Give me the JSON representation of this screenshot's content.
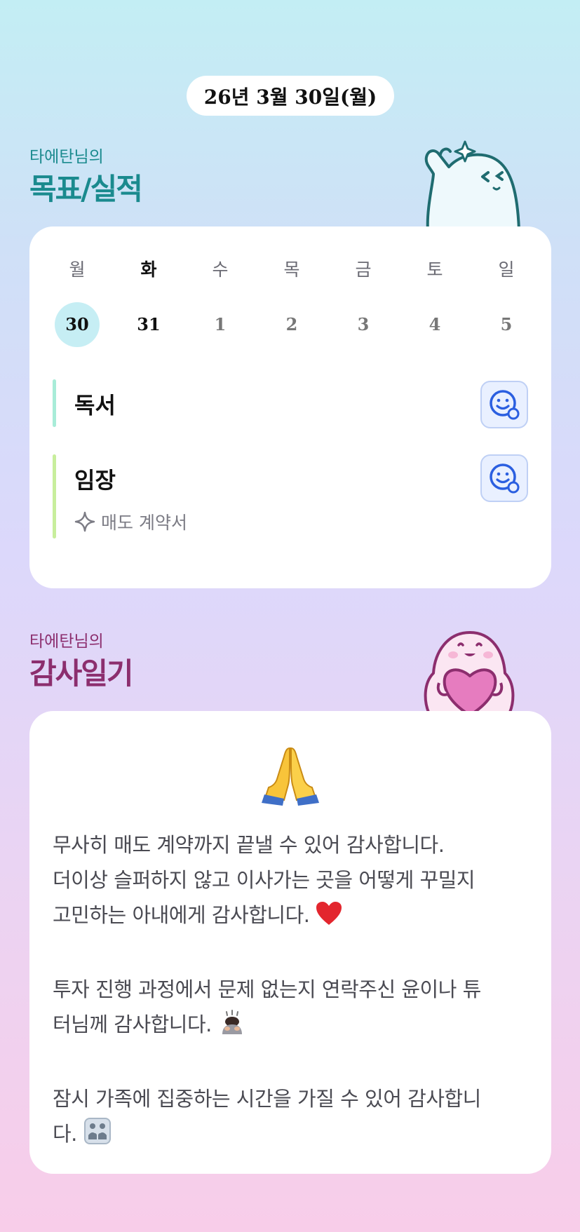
{
  "date_label": "26년 3월 30일(월)",
  "goals_section": {
    "owner": "타에탄님의",
    "title": "목표/실적"
  },
  "week": {
    "day_names": [
      "월",
      "화",
      "수",
      "목",
      "금",
      "토",
      "일"
    ],
    "day_numbers": [
      "30",
      "31",
      "1",
      "2",
      "3",
      "4",
      "5"
    ],
    "selected_index": 0
  },
  "goals": [
    {
      "label": "독서",
      "bar_color": "#a8ecd8",
      "icon": "smile-face-icon"
    },
    {
      "label": "임장",
      "bar_color": "#c8ee9c",
      "icon": "smile-face-icon",
      "subitem": "매도 계약서",
      "subitem_icon": "sparkle-icon"
    }
  ],
  "diary_section": {
    "owner": "타에탄님의",
    "title": "감사일기"
  },
  "diary": {
    "mood_emoji": "folded-hands-emoji",
    "paragraph1_line1": "무사히 매도 계약까지 끝낼 수 있어 감사합니다.",
    "paragraph1_line2": "더이상 슬퍼하지 않고 이사가는 곳을 어떻게 꾸밀지",
    "paragraph1_line3": "고민하는 아내에게 감사합니다.",
    "paragraph2_line1": "투자 진행 과정에서 문제 없는지 연락주신 윤이나 튜",
    "paragraph2_line2": "터님께 감사합니다.",
    "paragraph3_line1": "잠시 가족에 집중하는 시간을 가질 수 있어 감사합니",
    "paragraph3_line2": "다."
  },
  "colors": {
    "teal_title": "#1a8a8e",
    "plum_title": "#8c2e6e",
    "today_circle": "#c6eef4",
    "mood_icon": "#2b5fe0"
  }
}
